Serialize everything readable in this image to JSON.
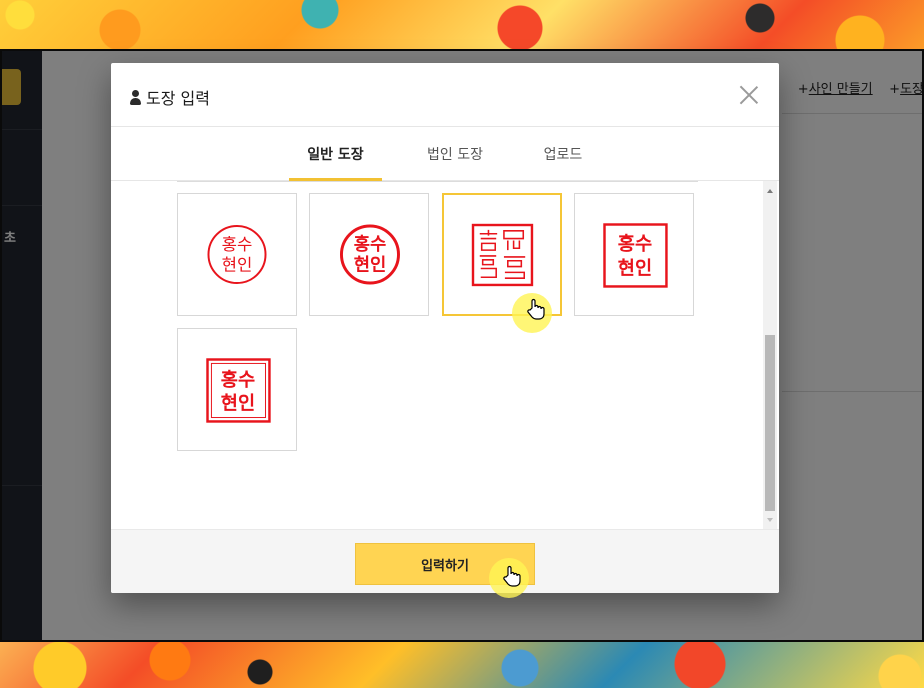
{
  "sidebar": {
    "partial_label": "초"
  },
  "main": {
    "links": [
      {
        "label": "사인 만들기",
        "prefix": "+"
      },
      {
        "label": "도장",
        "prefix": "+"
      }
    ]
  },
  "modal": {
    "title": "도장 입력",
    "tabs": [
      {
        "label": "일반 도장",
        "active": true
      },
      {
        "label": "법인 도장",
        "active": false
      },
      {
        "label": "업로드",
        "active": false
      }
    ],
    "stamps": [
      {
        "line1": "홍수",
        "line2": "현인",
        "style": "round-thin"
      },
      {
        "line1": "홍수",
        "line2": "현인",
        "style": "round-bold"
      },
      {
        "line1": "홍수",
        "line2": "현인",
        "style": "square-seal",
        "selected": true
      },
      {
        "line1": "홍수",
        "line2": "현인",
        "style": "square"
      },
      {
        "line1": "홍수",
        "line2": "현인",
        "style": "square-double"
      }
    ],
    "submit_label": "입력하기"
  },
  "colors": {
    "accent": "#ffd452",
    "stamp_red": "#e8141c",
    "selected_border": "#f5c636"
  }
}
